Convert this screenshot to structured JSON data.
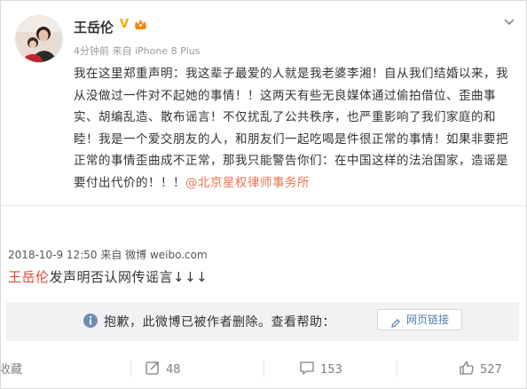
{
  "post": {
    "author": "王岳伦",
    "meta": "4分钟前 来自 iPhone 8 Plus",
    "text_parts": [
      "我在这里郑重声明：我这辈子最爱的人就是我老婆李湘！自从我们结婚以来，我从没做过一件对不起她的事情！！这两天有些无良媒体通过偷拍借位、歪曲事实、胡编乱造、散布谣言！不仅扰乱了公共秩序，也严重影响了我们家庭的和睦！我是一个爱交朋友的人，和朋友们一起吃喝是件很正常的事情！如果非要把正常的事情歪曲成不正常，那我只能警告你们：在中国这样的法治国家，造谣是要付出代价的！！！"
    ],
    "mention": "@北京星权律师事务所"
  },
  "repost": {
    "meta": "2018-10-9 12:50 来自 微博 weibo.com",
    "name": "王岳伦",
    "text": "发声明否认网传谣言↓↓↓"
  },
  "notice": {
    "text": "抱歉，此微博已被作者删除。查看帮助：",
    "link_label": "网页链接"
  },
  "actions": {
    "favorite": "收藏",
    "repost_count": "48",
    "comment_count": "153",
    "like_count": "527"
  },
  "colors": {
    "accent": "#eb7350",
    "name_red": "#e8402e",
    "link_blue": "#507daf",
    "notice_bg": "#f2f2f5"
  },
  "icons": [
    "avatar",
    "verified-icon",
    "vip-crown-icon",
    "chevron-down-icon",
    "info-icon",
    "pencil-icon",
    "share-icon",
    "comment-icon",
    "like-icon"
  ]
}
